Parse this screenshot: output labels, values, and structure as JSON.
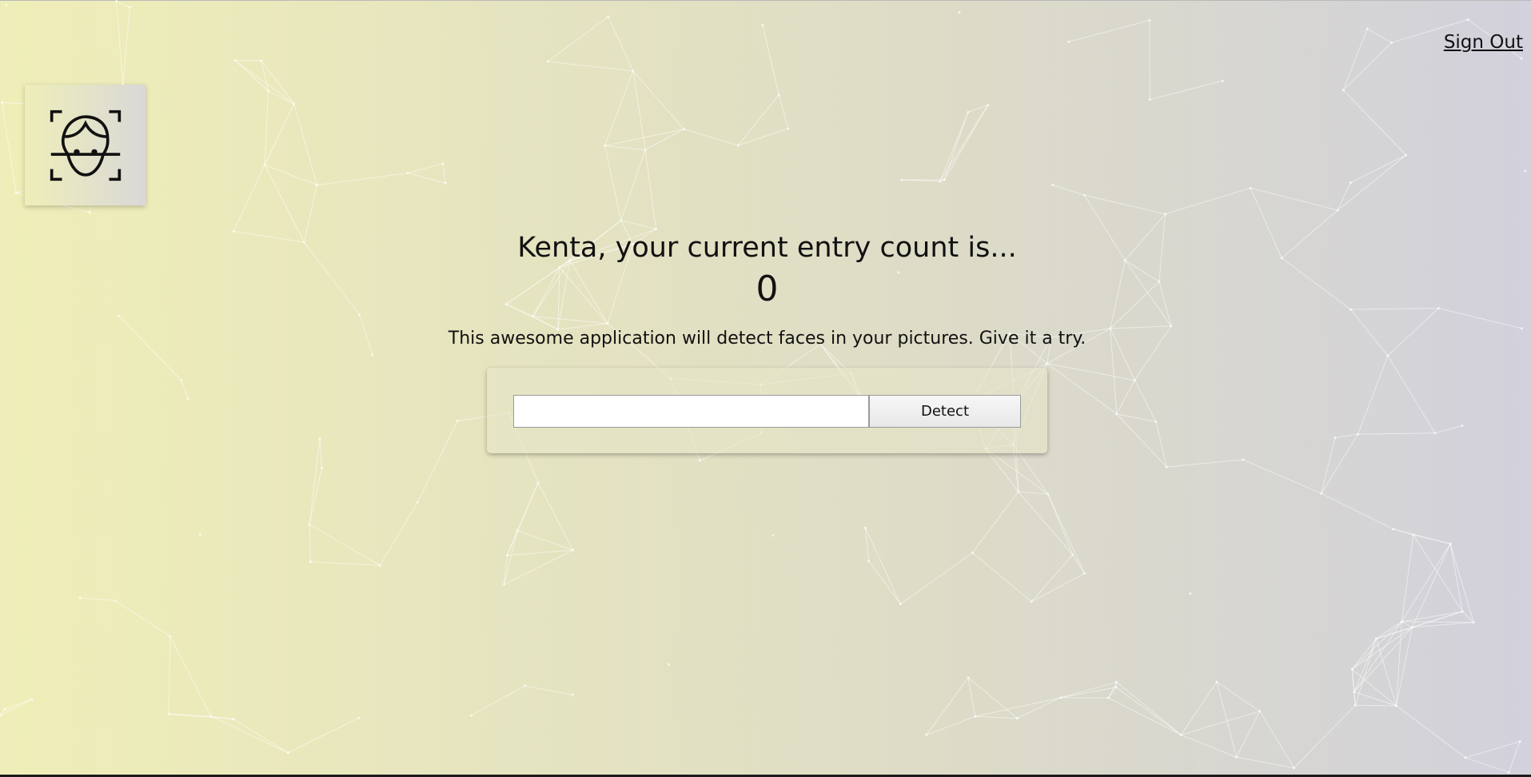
{
  "header": {
    "logo_icon": "face-recognition-icon",
    "signout_label": "Sign Out"
  },
  "main": {
    "headline": "Kenta, your current entry count is...",
    "entry_count": "0",
    "subtitle": "This awesome application will detect faces in your pictures. Give it a try.",
    "form": {
      "input_value": "",
      "input_placeholder": "",
      "detect_label": "Detect"
    }
  },
  "colors": {
    "background_left": "#efeeb8",
    "background_right": "#d2d1dc",
    "text": "#111111"
  }
}
